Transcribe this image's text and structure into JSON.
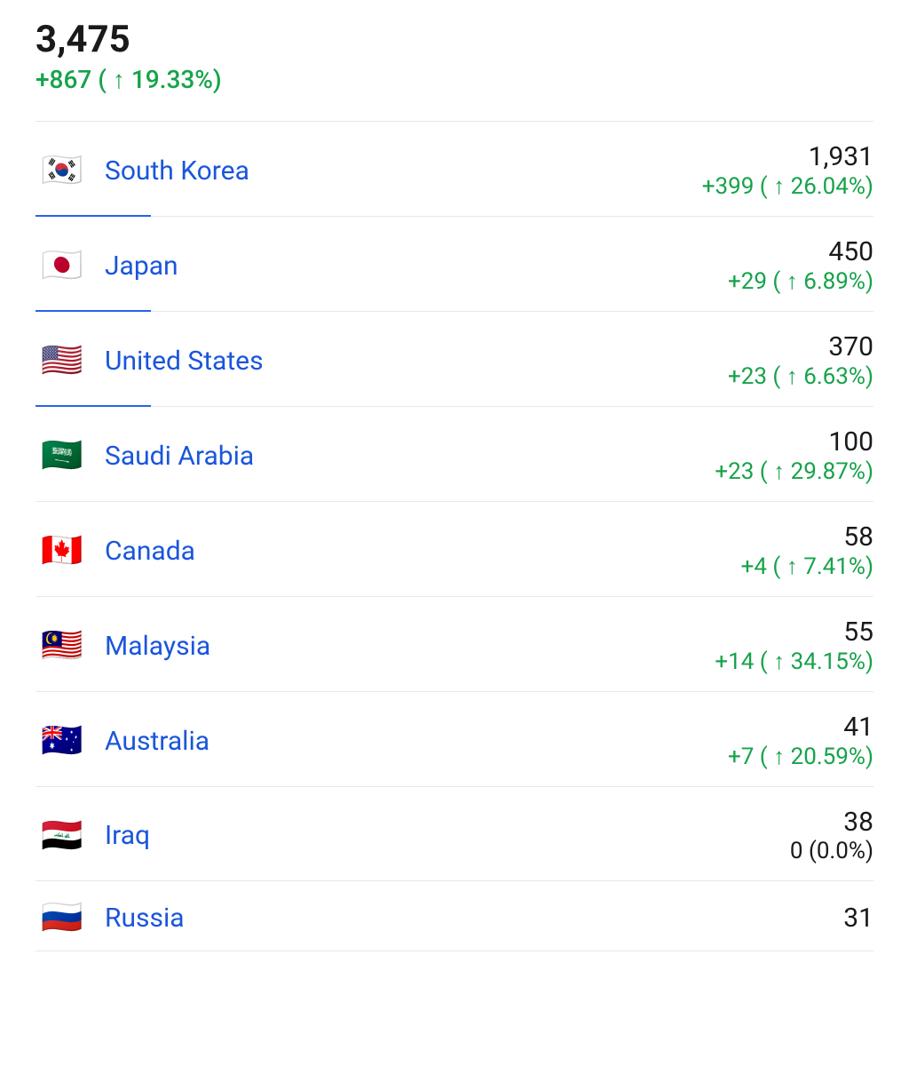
{
  "header": {
    "total": "3,475",
    "change": "+867 ( ↑ 19.33%)"
  },
  "countries": [
    {
      "name": "South Korea",
      "flag": "🇰🇷",
      "count": "1,931",
      "change": "+399 ( ↑ 26.04%)",
      "neutral": false,
      "showLine": true
    },
    {
      "name": "Japan",
      "flag": "🇯🇵",
      "count": "450",
      "change": "+29 ( ↑ 6.89%)",
      "neutral": false,
      "showLine": true
    },
    {
      "name": "United States",
      "flag": "🇺🇸",
      "count": "370",
      "change": "+23 ( ↑ 6.63%)",
      "neutral": false,
      "showLine": true
    },
    {
      "name": "Saudi Arabia",
      "flag": "🇸🇦",
      "count": "100",
      "change": "+23 ( ↑ 29.87%)",
      "neutral": false,
      "showLine": false
    },
    {
      "name": "Canada",
      "flag": "🇨🇦",
      "count": "58",
      "change": "+4 ( ↑ 7.41%)",
      "neutral": false,
      "showLine": false
    },
    {
      "name": "Malaysia",
      "flag": "🇲🇾",
      "count": "55",
      "change": "+14 ( ↑ 34.15%)",
      "neutral": false,
      "showLine": false
    },
    {
      "name": "Australia",
      "flag": "🇦🇺",
      "count": "41",
      "change": "+7 ( ↑ 20.59%)",
      "neutral": false,
      "showLine": false
    },
    {
      "name": "Iraq",
      "flag": "🇮🇶",
      "count": "38",
      "change": "0 (0.0%)",
      "neutral": true,
      "showLine": false
    },
    {
      "name": "Russia",
      "flag": "🇷🇺",
      "count": "31",
      "change": "",
      "neutral": false,
      "showLine": false
    }
  ]
}
